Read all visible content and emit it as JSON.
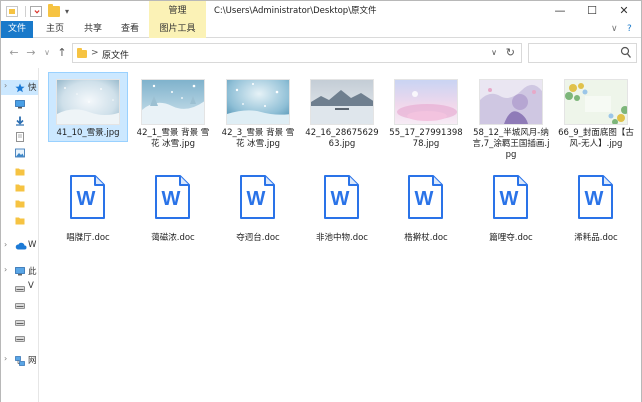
{
  "window": {
    "title_path": "C:\\Users\\Administrator\\Desktop\\原文件",
    "context_tab": "管理",
    "minimize": "—",
    "maximize": "☐",
    "close": "✕"
  },
  "ribbon": {
    "tabs": [
      "文件",
      "主页",
      "共享",
      "查看",
      "图片工具"
    ],
    "chevron": "∨",
    "help": "?"
  },
  "address": {
    "back": "←",
    "forward": "→",
    "recent": "∨",
    "up": "↑",
    "crumb_sep": ">",
    "crumb": "原文件",
    "dropdown": "∨",
    "refresh": "↻",
    "search_placeholder": ""
  },
  "nav": {
    "items": [
      {
        "label": "快",
        "icon": "star-icon",
        "selected": true
      },
      {
        "label": "",
        "icon": "desktop-icon"
      },
      {
        "label": "",
        "icon": "download-icon"
      },
      {
        "label": "",
        "icon": "document-icon"
      },
      {
        "label": "",
        "icon": "picture-icon"
      },
      {
        "label": "",
        "icon": "folder-icon"
      },
      {
        "label": "",
        "icon": "folder-icon"
      },
      {
        "label": "",
        "icon": "folder-icon"
      },
      {
        "label": "",
        "icon": "folder-icon"
      },
      {
        "label": "W",
        "icon": "onedrive-icon"
      },
      {
        "label": "此",
        "icon": "this-pc-icon"
      },
      {
        "label": "V",
        "icon": "drive-icon"
      },
      {
        "label": "",
        "icon": "drive-icon"
      },
      {
        "label": "",
        "icon": "drive-icon"
      },
      {
        "label": "",
        "icon": "drive-icon"
      },
      {
        "label": "网",
        "icon": "network-icon"
      }
    ]
  },
  "files": {
    "images": [
      {
        "name": "41_10_雪景.jpg",
        "selected": true
      },
      {
        "name": "42_1_雪景 背景 雪花 冰雪.jpg"
      },
      {
        "name": "42_3_雪景 背景 雪花 冰雪.jpg"
      },
      {
        "name": "42_16_2867562963.jpg"
      },
      {
        "name": "55_17_2799139878.jpg"
      },
      {
        "name": "58_12_半城风月-纳言,7_涂羁王国插画.jpg"
      },
      {
        "name": "66_9_封面底图【古风-无人】.jpg"
      }
    ],
    "docs": [
      {
        "name": "唱牒厅.doc"
      },
      {
        "name": "蔼磁浓.doc"
      },
      {
        "name": "夺迥台.doc"
      },
      {
        "name": "非池中物.doc"
      },
      {
        "name": "梏擀杖.doc"
      },
      {
        "name": "篇哩夺.doc"
      },
      {
        "name": "浠耗品.doc"
      }
    ],
    "word_glyph": "W"
  },
  "colors": {
    "accent": "#1979ca",
    "context_tab": "#fbf2b6",
    "selection": "#cce8ff",
    "wps_blue": "#2a73e8"
  }
}
